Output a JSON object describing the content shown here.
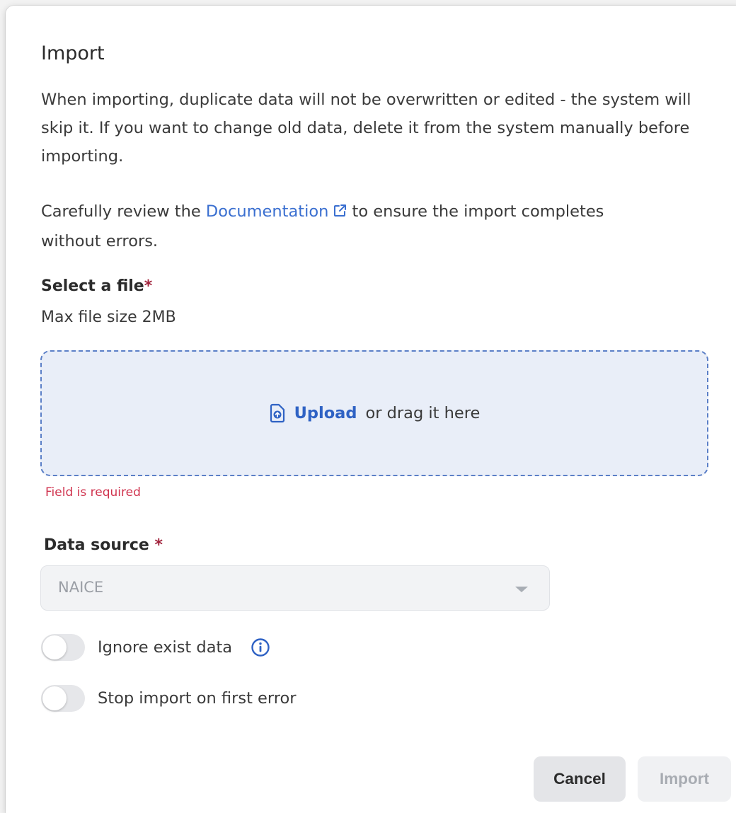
{
  "dialog": {
    "title": "Import",
    "description": "When importing, duplicate data will not be overwritten or edited - the system will skip it. If you want to change old data, delete it from the system manually before importing.",
    "review_prefix": "Carefully review the ",
    "documentation_link": "Documentation",
    "review_suffix": " to ensure the import completes without errors."
  },
  "file": {
    "label": "Select a file",
    "required_mark": "*",
    "hint": "Max file size 2MB",
    "upload_link": "Upload",
    "drag_text": "or drag it here",
    "error": "Field is required"
  },
  "data_source": {
    "label": "Data source",
    "required_mark": "*",
    "selected_value": "NAICE"
  },
  "options": {
    "ignore_exist_label": "Ignore exist data",
    "ignore_exist_enabled": false,
    "stop_on_error_label": "Stop import on first error",
    "stop_on_error_enabled": false
  },
  "buttons": {
    "cancel": "Cancel",
    "import": "Import"
  },
  "colors": {
    "link": "#3a6fd0",
    "error": "#d0344f",
    "required": "#a0213a",
    "dropzone_bg": "#e9eef8",
    "dropzone_border": "#5b7fc7"
  },
  "icons": {
    "external_link": "external-link-icon",
    "upload": "file-upload-icon",
    "info": "info-icon",
    "caret": "chevron-down-icon"
  }
}
